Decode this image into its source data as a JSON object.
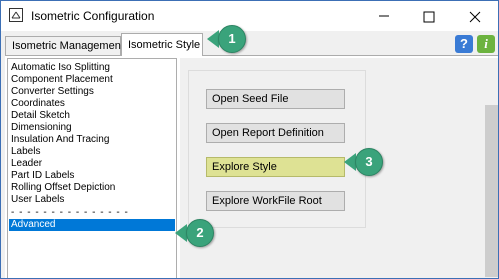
{
  "window": {
    "title": "Isometric Configuration"
  },
  "tabs": [
    {
      "label": "Isometric Management",
      "active": false
    },
    {
      "label": "Isometric Style",
      "active": true
    }
  ],
  "icons": {
    "help": "?",
    "info": "i"
  },
  "list": {
    "items": [
      "Automatic Iso Splitting",
      "Component Placement",
      "Converter Settings",
      "Coordinates",
      "Detail Sketch",
      "Dimensioning",
      "Insulation And Tracing",
      "Labels",
      "Leader",
      "Part ID Labels",
      "Rolling Offset Depiction",
      "User Labels",
      "- - - - - - - - - - - - - - -",
      "Advanced"
    ],
    "selected": "Advanced"
  },
  "buttons": {
    "open_seed_file": "Open Seed File",
    "open_report_definition": "Open Report Definition",
    "explore_style": "Explore Style",
    "explore_workfile_root": "Explore WorkFile Root"
  },
  "callouts": {
    "one": "1",
    "two": "2",
    "three": "3"
  },
  "colors": {
    "selection": "#0078d7",
    "highlight_button": "#dee294",
    "callout": "#3aa37b"
  }
}
